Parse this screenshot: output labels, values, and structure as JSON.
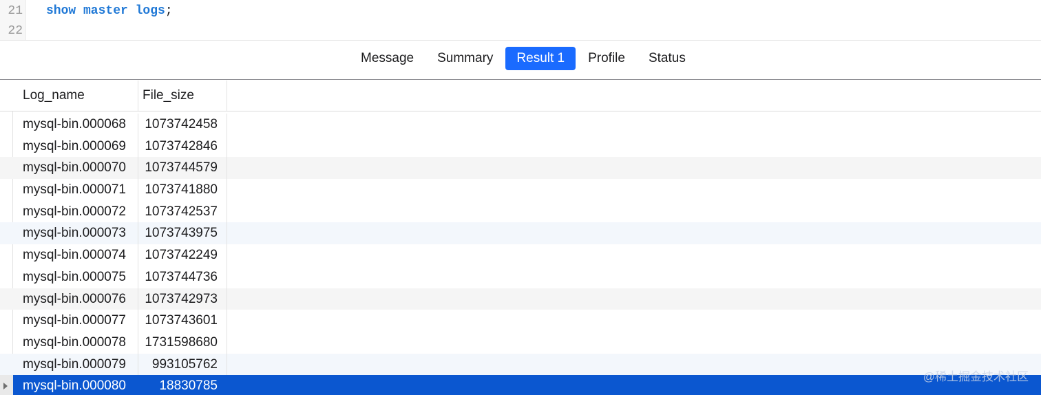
{
  "editor": {
    "lines": [
      {
        "number": "21",
        "keywords": "show master logs",
        "terminator": ";"
      },
      {
        "number": "22",
        "keywords": "",
        "terminator": ""
      }
    ]
  },
  "tabs": [
    {
      "label": "Message",
      "active": false
    },
    {
      "label": "Summary",
      "active": false
    },
    {
      "label": "Result 1",
      "active": true
    },
    {
      "label": "Profile",
      "active": false
    },
    {
      "label": "Status",
      "active": false
    }
  ],
  "table": {
    "columns": [
      "Log_name",
      "File_size"
    ],
    "rows": [
      [
        "mysql-bin.000068",
        "1073742458"
      ],
      [
        "mysql-bin.000069",
        "1073742846"
      ],
      [
        "mysql-bin.000070",
        "1073744579"
      ],
      [
        "mysql-bin.000071",
        "1073741880"
      ],
      [
        "mysql-bin.000072",
        "1073742537"
      ],
      [
        "mysql-bin.000073",
        "1073743975"
      ],
      [
        "mysql-bin.000074",
        "1073742249"
      ],
      [
        "mysql-bin.000075",
        "1073744736"
      ],
      [
        "mysql-bin.000076",
        "1073742973"
      ],
      [
        "mysql-bin.000077",
        "1073743601"
      ],
      [
        "mysql-bin.000078",
        "1731598680"
      ],
      [
        "mysql-bin.000079",
        "993105762"
      ],
      [
        "mysql-bin.000080",
        "18830785"
      ]
    ],
    "selected_row": 12
  },
  "watermark": "@稀土掘金技术社区",
  "colors": {
    "accent": "#1a6bff",
    "selection": "#0b57d0",
    "keyword": "#1f78d6"
  }
}
